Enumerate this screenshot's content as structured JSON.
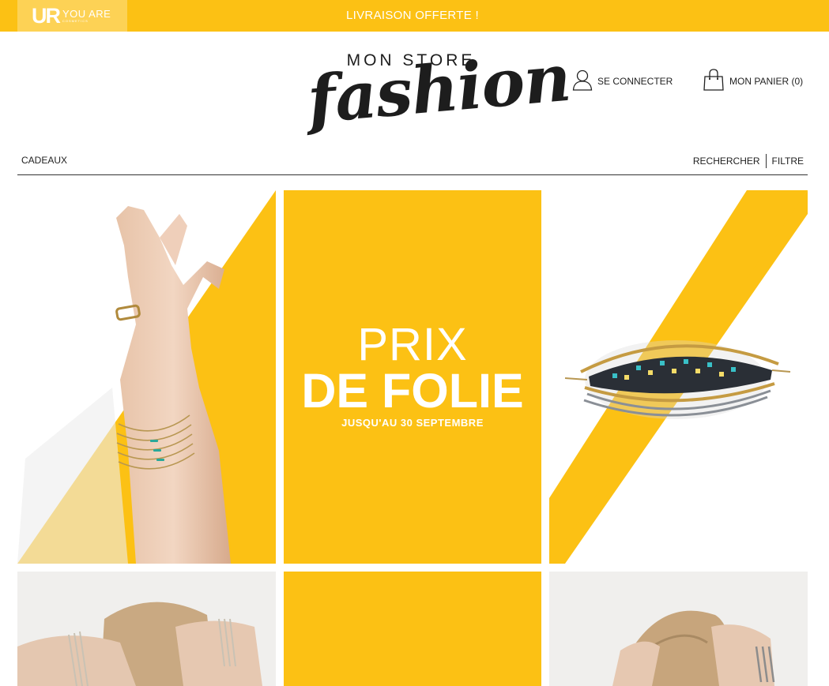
{
  "topbar": {
    "brand_letters": "UR",
    "brand_name": "YOU ARE",
    "brand_sub": "COSMETICS",
    "promo": "LIVRAISON OFFERTE !",
    "color": "#fcc114"
  },
  "header": {
    "logo_top": "MON STORE",
    "logo_script": "fashion",
    "account_label": "SE CONNECTER",
    "account_icon": "user-icon",
    "cart_label": "MON PANIER (0)",
    "cart_icon": "shopping-bag-icon"
  },
  "nav": {
    "left_item": "CADEAUX",
    "search": "RECHERCHER",
    "filter": "FILTRE"
  },
  "grid": {
    "promo_tile": {
      "line1": "PRIX",
      "line2": "DE FOLIE",
      "line3": "JUSQU'AU 30 SEPTEMBRE"
    },
    "accent_color": "#fcc114"
  }
}
